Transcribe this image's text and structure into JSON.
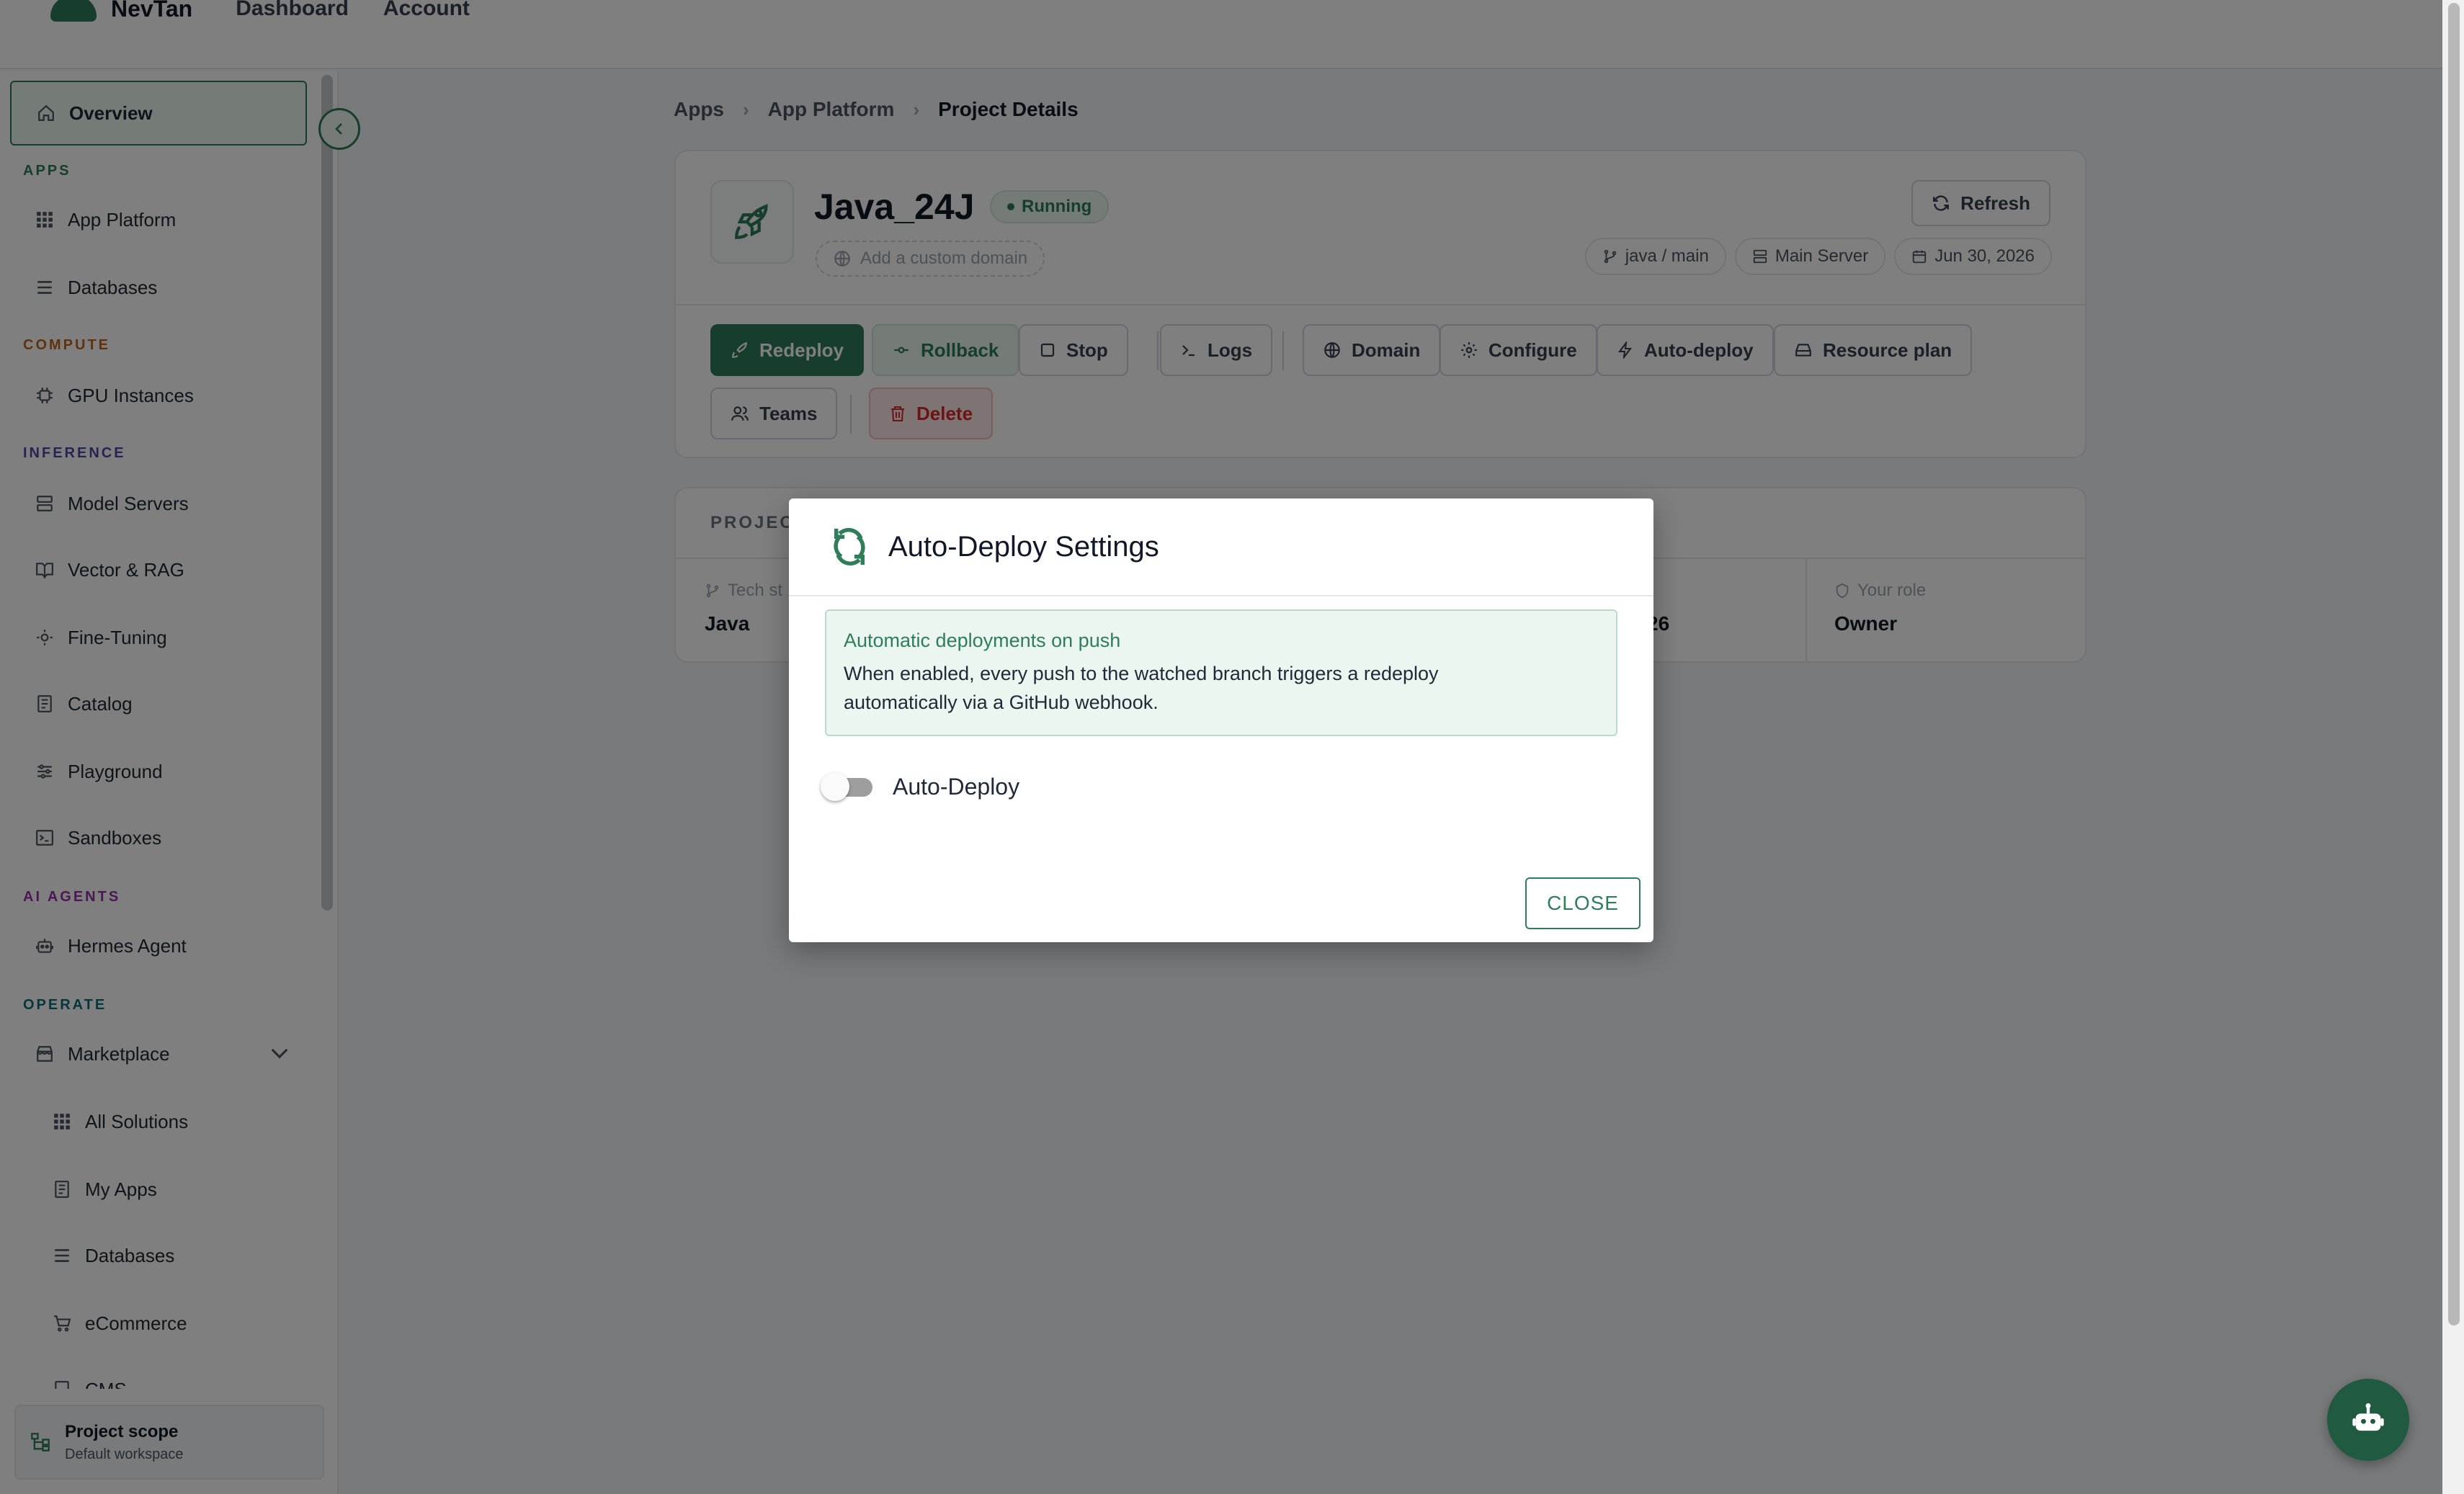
{
  "app": {
    "brand": "NevTan",
    "nav": [
      "Dashboard",
      "Account"
    ]
  },
  "sidebar": {
    "overview": "Overview",
    "sections": {
      "apps": "APPS",
      "compute": "COMPUTE",
      "inference": "INFERENCE",
      "ai_agents": "AI AGENTS",
      "operate": "OPERATE"
    },
    "section_colors": {
      "apps": "#2f7d5b",
      "compute": "#c0651d",
      "inference": "#4f46a5",
      "ai_agents": "#9333a8",
      "operate": "#0f6f7d"
    },
    "items": {
      "app_platform": "App Platform",
      "databases": "Databases",
      "gpu_instances": "GPU Instances",
      "model_servers": "Model Servers",
      "vector_rag": "Vector & RAG",
      "fine_tuning": "Fine-Tuning",
      "catalog": "Catalog",
      "playground": "Playground",
      "sandboxes": "Sandboxes",
      "hermes_agent": "Hermes Agent",
      "marketplace": "Marketplace",
      "all_solutions": "All Solutions",
      "my_apps": "My Apps",
      "databases_sub": "Databases",
      "ecommerce": "eCommerce",
      "cms_partial": "CMS"
    },
    "scope": {
      "title": "Project scope",
      "subtitle": "Default workspace"
    }
  },
  "breadcrumb": [
    "Apps",
    "App Platform",
    "Project Details"
  ],
  "project": {
    "name": "Java_24J",
    "status": "Running",
    "custom_domain_placeholder": "Add a custom domain",
    "refresh": "Refresh",
    "branch": "java / main",
    "server": "Main Server",
    "date": "Jun 30, 2026",
    "actions": {
      "redeploy": "Redeploy",
      "rollback": "Rollback",
      "stop": "Stop",
      "logs": "Logs",
      "domain": "Domain",
      "configure": "Configure",
      "auto_deploy": "Auto-deploy",
      "resource_plan": "Resource plan",
      "teams": "Teams",
      "delete": "Delete"
    }
  },
  "project_info": {
    "header_partial": "PROJECT",
    "tech_stack_label_partial": "Tech st",
    "tech_stack_value": "Java",
    "date_value_partial": "26",
    "role_label": "Your role",
    "role_value": "Owner"
  },
  "modal": {
    "title": "Auto-Deploy Settings",
    "info_title": "Automatic deployments on push",
    "info_body": "When enabled, every push to the watched branch triggers a redeploy automatically via a GitHub webhook.",
    "toggle_label": "Auto-Deploy",
    "toggle_on": false,
    "close": "CLOSE"
  },
  "colors": {
    "accent": "#2f7d5b",
    "danger": "#dc2626"
  }
}
